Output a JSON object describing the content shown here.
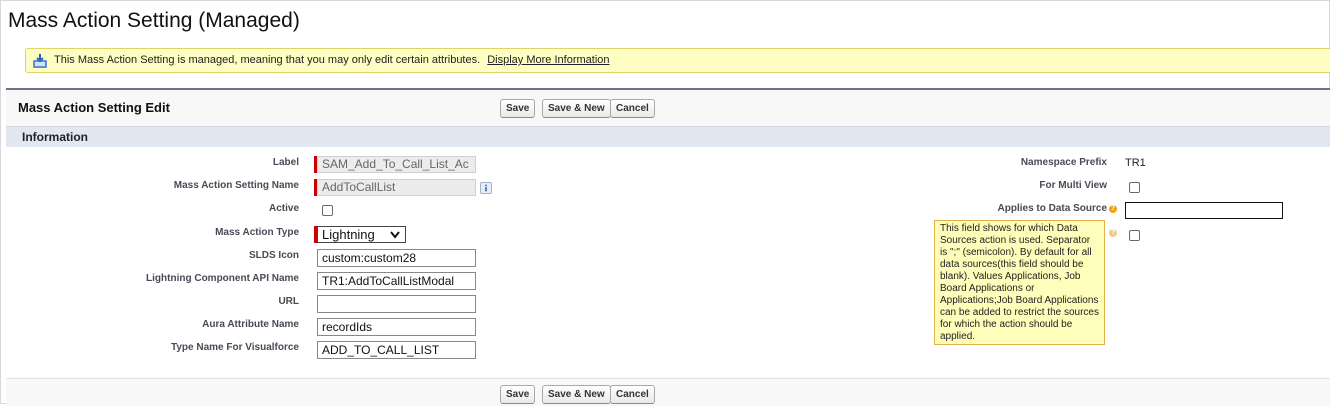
{
  "page": {
    "title": "Mass Action Setting (Managed)"
  },
  "banner": {
    "icon": "managed-package-icon",
    "text": "This Mass Action Setting is managed, meaning that you may only edit certain attributes.",
    "link": "Display More Information"
  },
  "edit_block": {
    "title": "Mass Action Setting Edit",
    "buttons": {
      "save": "Save",
      "save_new": "Save & New",
      "cancel": "Cancel"
    }
  },
  "section": {
    "title": "Information"
  },
  "left_fields": {
    "label": {
      "label": "Label",
      "value": "SAM_Add_To_Call_List_Ac"
    },
    "setting_name": {
      "label": "Mass Action Setting Name",
      "value": "AddToCallList"
    },
    "active": {
      "label": "Active",
      "checked": false
    },
    "action_type": {
      "label": "Mass Action Type",
      "value": "Lightning"
    },
    "slds_icon": {
      "label": "SLDS Icon",
      "value": "custom:custom28"
    },
    "component_api": {
      "label": "Lightning Component API Name",
      "value": "TR1:AddToCallListModal"
    },
    "url": {
      "label": "URL",
      "value": ""
    },
    "aura_attr": {
      "label": "Aura Attribute Name",
      "value": "recordIds"
    },
    "vf_type": {
      "label": "Type Name For Visualforce",
      "value": "ADD_TO_CALL_LIST"
    }
  },
  "right_fields": {
    "namespace": {
      "label": "Namespace Prefix",
      "value": "TR1"
    },
    "multi_view": {
      "label": "For Multi View",
      "checked": false
    },
    "data_source": {
      "label": "Applies to Data Source",
      "value": ""
    },
    "hidden_field": {
      "checked": false
    }
  },
  "tooltip": {
    "text": "This field shows for which Data Sources action is used. Separator is \";\" (semicolon). By default for all data sources(this field should be blank). Values Applications, Job Board Applications or Applications;Job Board Applications can be added to restrict the sources for which the action should be applied."
  }
}
